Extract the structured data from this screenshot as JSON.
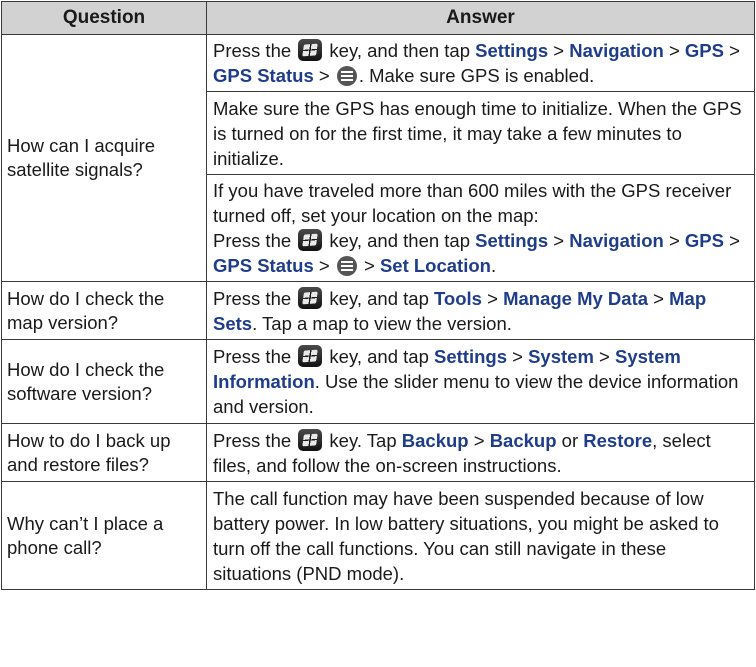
{
  "header": {
    "question": "Question",
    "answer": "Answer"
  },
  "rows": [
    {
      "question": "How can I acquire satellite signals?",
      "answers": [
        {
          "p1": "Press the ",
          "p2": " key, and then tap ",
          "settings": "Settings",
          "sep1": " > ",
          "navigation": "Navigation",
          "sep2": " > ",
          "gps": "GPS",
          "sep3": " > ",
          "gps_status": "GPS Status",
          "sep4": " > ",
          "tail": ". Make sure GPS is enabled."
        },
        {
          "text": "Make sure the GPS has enough time to initialize. When the GPS is turned on for the first time, it may take a few minutes to initialize."
        },
        {
          "intro": "If you have traveled more than 600 miles with the GPS receiver turned off, set your location on the map:",
          "p1": "Press the ",
          "p2": " key, and then tap ",
          "settings": "Settings",
          "sep1": " > ",
          "navigation": "Navigation",
          "sep2": " > ",
          "gps": "GPS",
          "sep3": " > ",
          "gps_status": "GPS Status",
          "sep4": " > ",
          "sep5": " > ",
          "set_location": "Set Location",
          "tail": "."
        }
      ]
    },
    {
      "question": "How do I check the map version?",
      "p1": "Press the ",
      "p2": " key, and tap ",
      "tools": "Tools",
      "sep1": " > ",
      "manage": "Manage My Data",
      "sep2": " > ",
      "map_sets": "Map Sets",
      "tail": ". Tap a map to view the version."
    },
    {
      "question": "How do I check the software version?",
      "p1": "Press the ",
      "p2": " key, and tap ",
      "settings": "Settings",
      "sep1": " > ",
      "system": "System",
      "sep2": " > ",
      "system_info": "System Information",
      "tail": ". Use the slider menu to view the device information and version."
    },
    {
      "question": "How to do I back up and restore files?",
      "p1": "Press the ",
      "p2": " key. Tap ",
      "backup": "Backup",
      "sep1": " > ",
      "backup2": "Backup",
      "or": " or ",
      "restore": "Restore",
      "tail": ", select files, and follow the on-screen instructions."
    },
    {
      "question": "Why can’t I place a phone call?",
      "text": "The call function may have been suspended because of low battery power. In low battery situations, you might be asked to turn off the call functions. You can still navigate in these situations (PND mode)."
    }
  ],
  "icons": {
    "start_key": "windows-start-key-icon",
    "menu": "menu-icon"
  },
  "colors": {
    "link_blue": "#1f3d8a",
    "header_bg": "#d2d2d2",
    "border": "#3a3a3a"
  }
}
